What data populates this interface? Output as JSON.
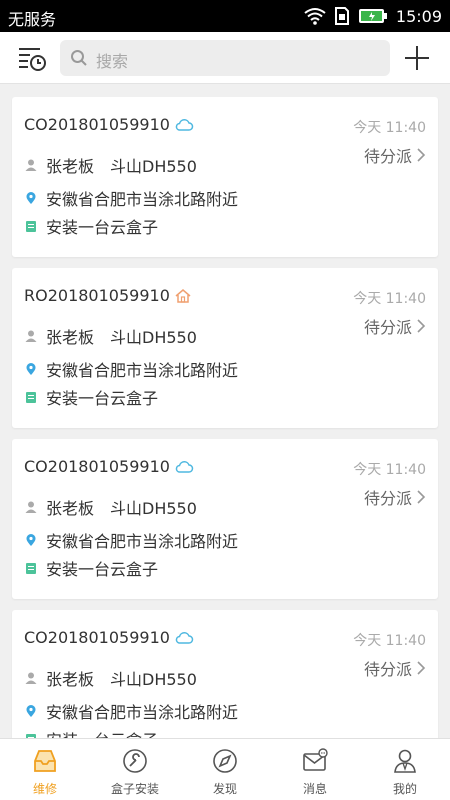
{
  "status_bar": {
    "carrier": "无服务",
    "time": "15:09"
  },
  "search": {
    "placeholder": "搜索"
  },
  "orders": [
    {
      "code": "CO201801059910",
      "type_icon": "cloud-icon",
      "time": "今天 11:40",
      "status": "待分派",
      "customer": "张老板",
      "machine": "斗山DH550",
      "address": "安徽省合肥市当涂北路附近",
      "task": "安装一台云盒子"
    },
    {
      "code": "RO201801059910",
      "type_icon": "house-icon",
      "time": "今天 11:40",
      "status": "待分派",
      "customer": "张老板",
      "machine": "斗山DH550",
      "address": "安徽省合肥市当涂北路附近",
      "task": "安装一台云盒子"
    },
    {
      "code": "CO201801059910",
      "type_icon": "cloud-icon",
      "time": "今天 11:40",
      "status": "待分派",
      "customer": "张老板",
      "machine": "斗山DH550",
      "address": "安徽省合肥市当涂北路附近",
      "task": "安装一台云盒子"
    },
    {
      "code": "CO201801059910",
      "type_icon": "cloud-icon",
      "time": "今天 11:40",
      "status": "待分派",
      "customer": "张老板",
      "machine": "斗山DH550",
      "address": "安徽省合肥市当涂北路附近",
      "task": "安装一台云盒子"
    }
  ],
  "tabs": [
    {
      "label": "维修",
      "icon": "repair-tray-icon",
      "active": true
    },
    {
      "label": "盒子安装",
      "icon": "wrench-icon",
      "active": false
    },
    {
      "label": "发现",
      "icon": "compass-icon",
      "active": false
    },
    {
      "label": "消息",
      "icon": "message-icon",
      "active": false
    },
    {
      "label": "我的",
      "icon": "user-icon",
      "active": false
    }
  ],
  "colors": {
    "accent": "#f0a020",
    "cloud": "#4fb8e0",
    "house": "#f0a070",
    "location": "#3aa6e0",
    "task": "#4cc39a"
  }
}
